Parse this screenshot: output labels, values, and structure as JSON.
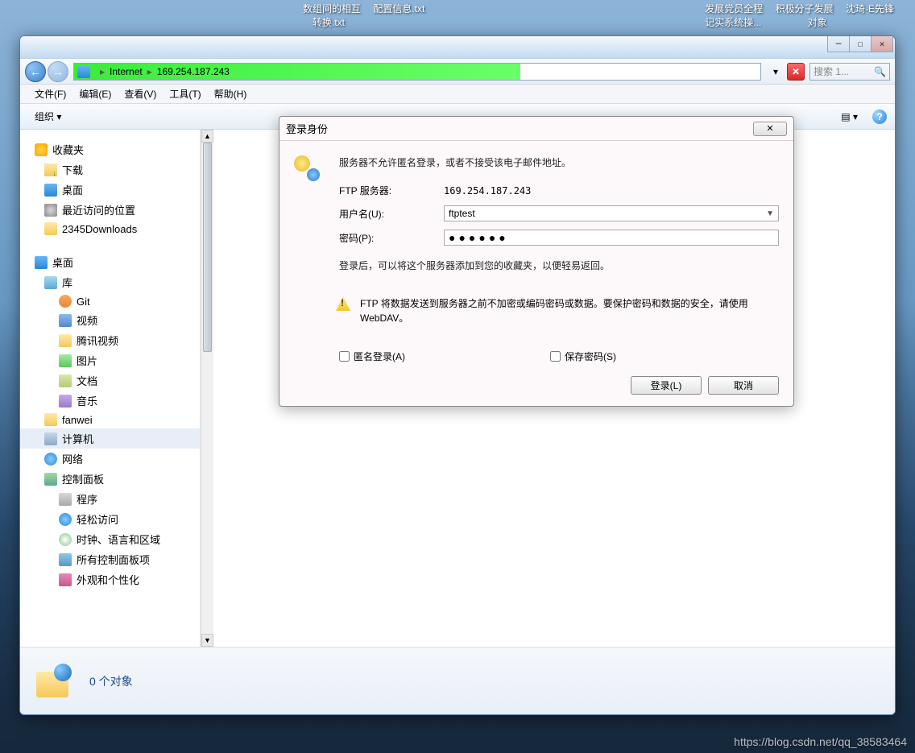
{
  "desktop": {
    "top_left": [
      "数组间的相互",
      "配置信息.txt",
      "转换.txt"
    ],
    "top_right": [
      "发展党员全程",
      "积极分子发展",
      "沈琦-E先锋",
      "记实系统操...",
      "对象"
    ]
  },
  "window": {
    "controls": {
      "min": "─",
      "max": "☐",
      "close": "✕"
    },
    "nav": {
      "back": "←",
      "fwd": "→"
    },
    "breadcrumb": {
      "root": "Internet",
      "sep": "▸",
      "addr": "169.254.187.243",
      "x": "✕"
    },
    "search": {
      "placeholder": "搜索 1..."
    },
    "menu": [
      "文件(F)",
      "编辑(E)",
      "查看(V)",
      "工具(T)",
      "帮助(H)"
    ],
    "toolbar": {
      "organize": "组织 ▾",
      "help": "?"
    },
    "sidebar": {
      "fav": "收藏夹",
      "fav_items": [
        "下载",
        "桌面",
        "最近访问的位置",
        "2345Downloads"
      ],
      "desk": "桌面",
      "lib": "库",
      "lib_items": [
        "Git",
        "视频",
        "腾讯视频",
        "图片",
        "文档",
        "音乐"
      ],
      "user": "fanwei",
      "pc": "计算机",
      "net": "网络",
      "cpl": "控制面板",
      "cpl_items": [
        "程序",
        "轻松访问",
        "时钟、语言和区域",
        "所有控制面板项",
        "外观和个性化"
      ]
    },
    "status": {
      "text": "0 个对象"
    }
  },
  "dialog": {
    "title": "登录身份",
    "close": "✕",
    "msg": "服务器不允许匿名登录，或者不接受该电子邮件地址。",
    "server_label": "FTP 服务器:",
    "server_value": "169.254.187.243",
    "user_label": "用户名(U):",
    "user_value": "ftptest",
    "pass_label": "密码(P):",
    "pass_value": "●●●●●●",
    "hint": "登录后，可以将这个服务器添加到您的收藏夹，以便轻易返回。",
    "warning": "FTP 将数据发送到服务器之前不加密或编码密码或数据。要保护密码和数据的安全，请使用 WebDAV。",
    "anon": "匿名登录(A)",
    "save": "保存密码(S)",
    "login_btn": "登录(L)",
    "cancel_btn": "取消"
  },
  "watermark": "https://blog.csdn.net/qq_38583464"
}
